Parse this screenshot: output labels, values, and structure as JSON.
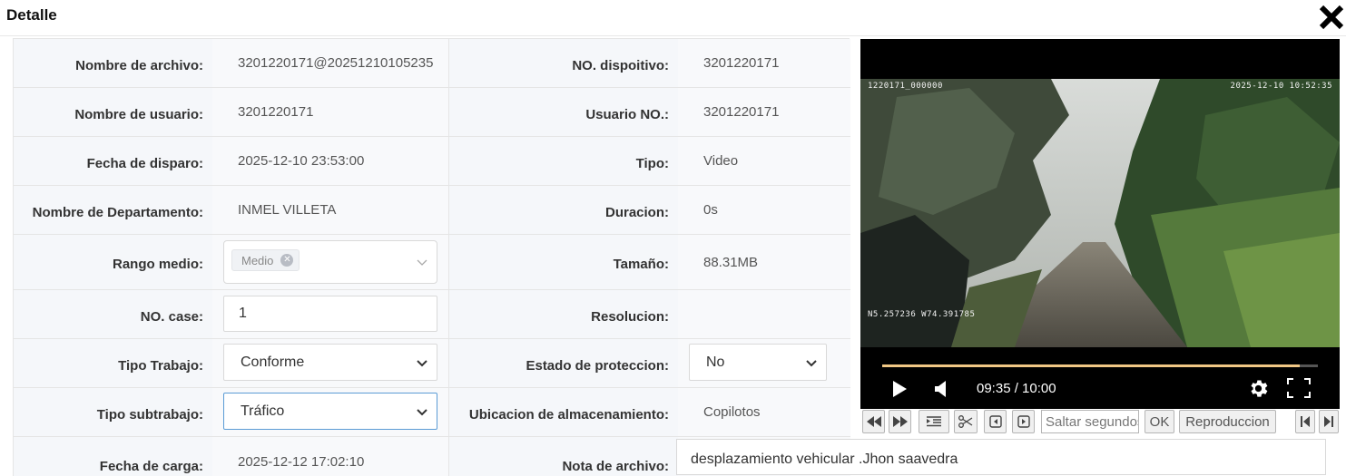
{
  "header": {
    "title": "Detalle",
    "close_icon": "close-icon"
  },
  "form": {
    "rows": [
      {
        "label1": "Nombre de archivo:",
        "value1": "3201220171@20251210105235",
        "label2": "NO. dispoitivo:",
        "value2": "3201220171"
      },
      {
        "label1": "Nombre de usuario:",
        "value1": "3201220171",
        "label2": "Usuario NO.:",
        "value2": "3201220171"
      },
      {
        "label1": "Fecha de disparo:",
        "value1": "2025-12-10 23:53:00",
        "label2": "Tipo:",
        "value2": "Video"
      },
      {
        "label1": "Nombre de Departamento:",
        "value1": "INMEL VILLETA",
        "label2": "Duracion:",
        "value2": "0s"
      },
      {
        "label1": "Rango medio:",
        "label2": "Tamaño:",
        "value2": "88.31MB"
      },
      {
        "label1": "NO. case:",
        "label2": "Resolucion:",
        "value2": ""
      },
      {
        "label1": "Tipo Trabajo:",
        "label2": "Estado de proteccion:"
      },
      {
        "label1": "Tipo subtrabajo:",
        "label2": "Ubicacion de almacenamiento:",
        "value2": "Copilotos"
      },
      {
        "label1": "Fecha de carga:",
        "value1": "2025-12-12 17:02:10",
        "label2": "Nota de archivo:"
      }
    ],
    "rango_medio": {
      "tag": "Medio"
    },
    "case_number": "1",
    "tipo_trabajo": "Conforme",
    "estado_proteccion": "No",
    "tipo_subtrabajo": "Tráfico",
    "nota_archivo": "desplazamiento vehicular .Jhon saavedra"
  },
  "player": {
    "osd_top_left": "1220171_000000",
    "osd_top_right": "2025-12-10  10:52:35",
    "osd_gps": "N5.257236  W74.391785",
    "time": "09:35 / 10:00",
    "progress": 0.958,
    "accent_color": "#f0c785"
  },
  "toolbar": {
    "seek_placeholder": "Saltar segundos",
    "ok_label": "OK",
    "playback_label": "Reproduccion"
  }
}
